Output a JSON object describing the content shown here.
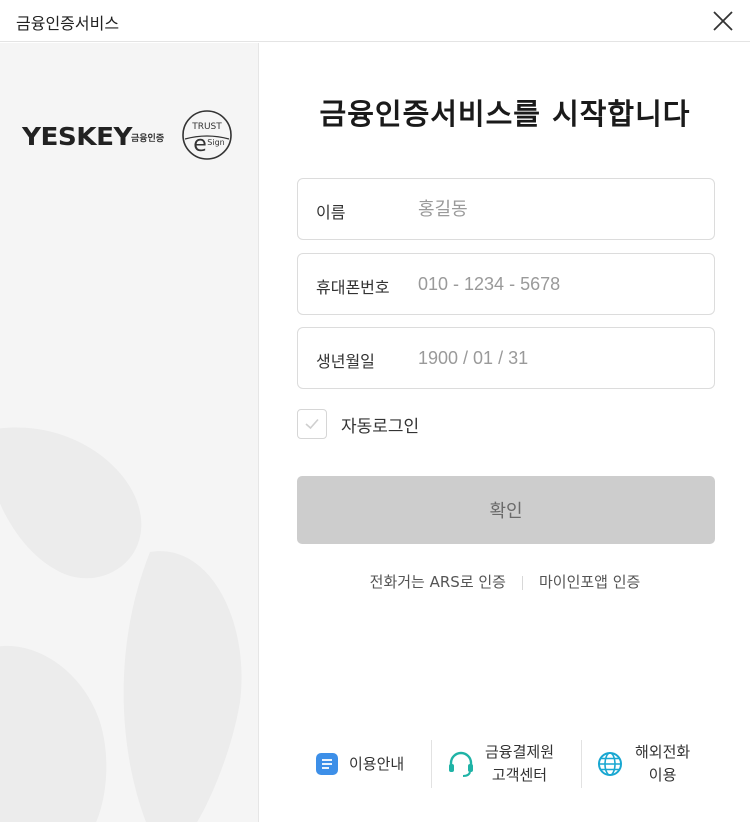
{
  "window": {
    "title": "금융인증서비스",
    "close_icon": "close-icon"
  },
  "left_panel": {
    "logo": {
      "brand": "YESKEY",
      "sub": "금융인증",
      "seal_top": "TRUST",
      "seal_mark": "e",
      "seal_side": "Sign"
    }
  },
  "main": {
    "heading": "금융인증서비스를 시작합니다",
    "fields": {
      "name": {
        "label": "이름",
        "value": "",
        "placeholder": "홍길동"
      },
      "phone": {
        "label": "휴대폰번호",
        "value": "",
        "placeholder": "010 - 1234 - 5678"
      },
      "birth": {
        "label": "생년월일",
        "value": "",
        "placeholder": "1900 / 01 / 31"
      }
    },
    "auto_login": {
      "label": "자동로그인",
      "checked": false
    },
    "confirm_label": "확인",
    "alt_links": {
      "ars": "전화거는 ARS로 인증",
      "app": "마이인포앱 인증"
    },
    "footer": {
      "guide": {
        "label": "이용안내",
        "icon": "document-icon"
      },
      "support": {
        "line1": "금융결제원",
        "line2": "고객센터",
        "icon": "headset-icon"
      },
      "overseas": {
        "line1": "해외전화",
        "line2": "이용",
        "icon": "globe-icon"
      }
    }
  },
  "colors": {
    "confirm_bg": "#cdcdcd",
    "left_bg": "#f5f5f5",
    "guide_icon": "#3d8fe8",
    "headset_icon": "#1fb3a6",
    "globe_icon": "#19a7d1"
  }
}
